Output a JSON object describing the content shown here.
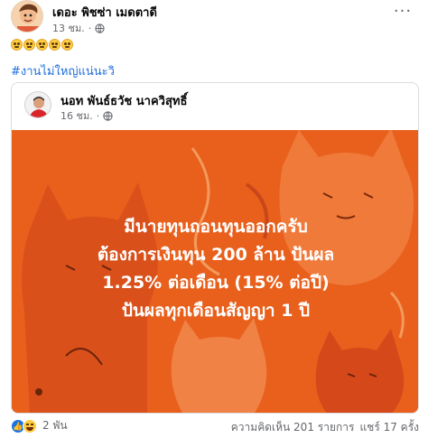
{
  "post": {
    "author": "เดอะ พิชซ่า เมดตาดี",
    "time": "13 ชม.",
    "privacy_icon": "globe-icon",
    "more_label": "···",
    "emoji_count": 5,
    "emoji_name": "laughing-crying-emoji",
    "hashtag": "#งานไม่ใหญ่แน่นะวิ"
  },
  "shared_post": {
    "author": "นอท พันธ์ธวัช นาควิสุทธิ์",
    "time": "16 ชม.",
    "privacy_icon": "globe-icon",
    "image_background": "#e8601c",
    "image_text": [
      "มีนายทุนถอนทุนออกครับ",
      "ต้องการเงินทุน 200 ล้าน ปันผล",
      "1.25% ต่อเดือน (15% ต่อปี)",
      "ปันผลทุกเดือนสัญญา 1 ปี"
    ]
  },
  "footer": {
    "reaction_icons": [
      "like-icon",
      "haha-icon"
    ],
    "reaction_count": "2 พัน",
    "comments": "ความคิดเห็น 201 รายการ",
    "shares": "แชร์ 17 ครั้ง"
  },
  "colors": {
    "link": "#216fdb",
    "secondary_text": "#65676b",
    "like_blue": "#1b74e4"
  }
}
